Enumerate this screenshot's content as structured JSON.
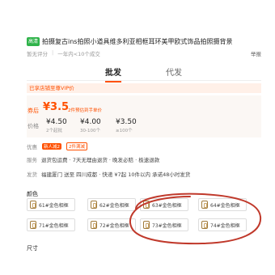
{
  "product": {
    "badge": "高清",
    "title": "拍摄复古ins拍照小道具维多利亚相框耳环美甲欧式饰品拍照摄背景",
    "rating": "暂无评分",
    "sales": "一年内<10个成交",
    "report": "举报"
  },
  "tabs": [
    {
      "label": "批发"
    },
    {
      "label": "代发"
    }
  ],
  "vip_text": "已享店铺至尊VIP价",
  "price": {
    "coupon_label": "券后",
    "coupon_price": "¥3.5",
    "coupon_note": "2件预估到手单价",
    "price_label": "价格",
    "tiers": [
      {
        "price": "¥4.50",
        "qty": "2个起批"
      },
      {
        "price": "¥4.00",
        "qty": "30-100个"
      },
      {
        "price": "¥3.50",
        "qty": "≥100个"
      }
    ]
  },
  "benefits": {
    "label": "优惠",
    "chip_new": "新人减2",
    "chip_disc": "2件满减"
  },
  "service": {
    "label": "服务",
    "value": "退货包运费 · 7天无理由退货 · 晚发必赔 · 极速退款"
  },
  "shipping": {
    "label": "发货",
    "value": "福建厦门 送至 四川成都 · 快递 ¥7起 10件以内 承诺48小时发货"
  },
  "color_label": "颜色",
  "size_label": "尺寸",
  "skus": [
    {
      "label": "61#金色相框"
    },
    {
      "label": "62#金色相框"
    },
    {
      "label": "63#金色相框"
    },
    {
      "label": "64#金色相框"
    },
    {
      "label": "71#金色相框"
    },
    {
      "label": "72#金色相框"
    },
    {
      "label": "73#金色相框"
    },
    {
      "label": "74#金色相框"
    }
  ],
  "annotation_color": "#c0392b",
  "accent_color": "#ff5000"
}
